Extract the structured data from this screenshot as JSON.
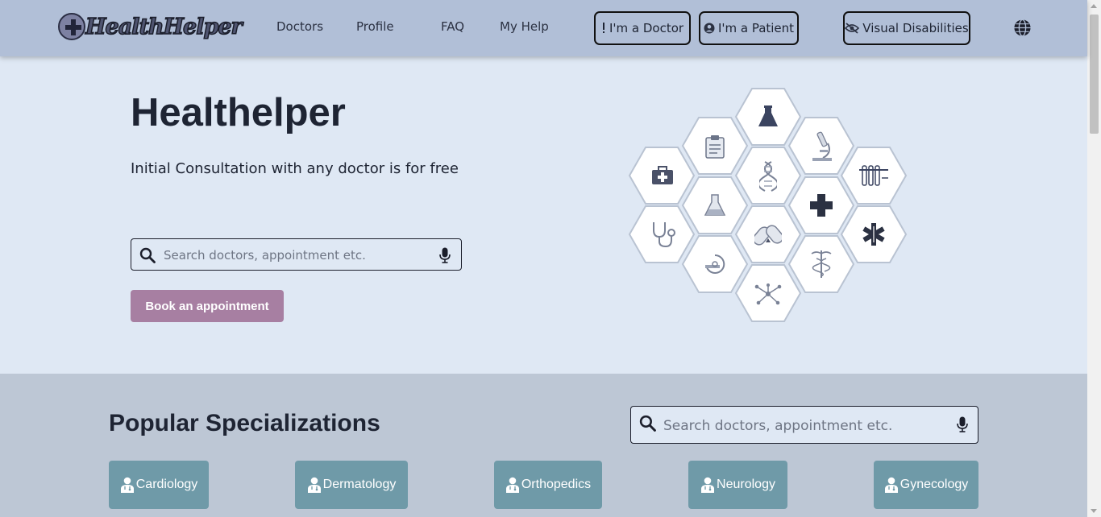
{
  "brand": {
    "name": "HealthHelper"
  },
  "nav": {
    "links": [
      "Doctors",
      "Profile",
      "FAQ",
      "My Help"
    ],
    "doctor_btn": "I'm a Doctor",
    "patient_btn": "I'm a Patient",
    "visual_btn": "Visual Disabilities"
  },
  "hero": {
    "title": "Healthelper",
    "subtitle": "Initial Consultation with any doctor is for free",
    "search_placeholder": "Search doctors, appointment etc.",
    "book_label": "Book an appointment"
  },
  "popular": {
    "title": "Popular Specializations",
    "search_placeholder": "Search doctors, appointment etc.",
    "specializations": [
      "Cardiology",
      "Dermatology",
      "Orthopedics",
      "Neurology",
      "Gynecology"
    ]
  },
  "hex_icons": [
    "flask-icon",
    "clipboard-icon",
    "microscope-icon",
    "first-aid-kit-icon",
    "dna-icon",
    "test-tubes-icon",
    "lab-flask-icon",
    "medical-cross-icon",
    "stethoscope-icon",
    "pills-icon",
    "star-of-life-icon",
    "mri-scanner-icon",
    "caduceus-icon",
    "molecule-icon"
  ],
  "colors": {
    "navbar": "#b1bfd7",
    "hero_bg": "#dfe8f4",
    "section_bg": "#bdc7d5",
    "book_btn": "#a77fa2",
    "spec_card": "#6f9aa8"
  }
}
